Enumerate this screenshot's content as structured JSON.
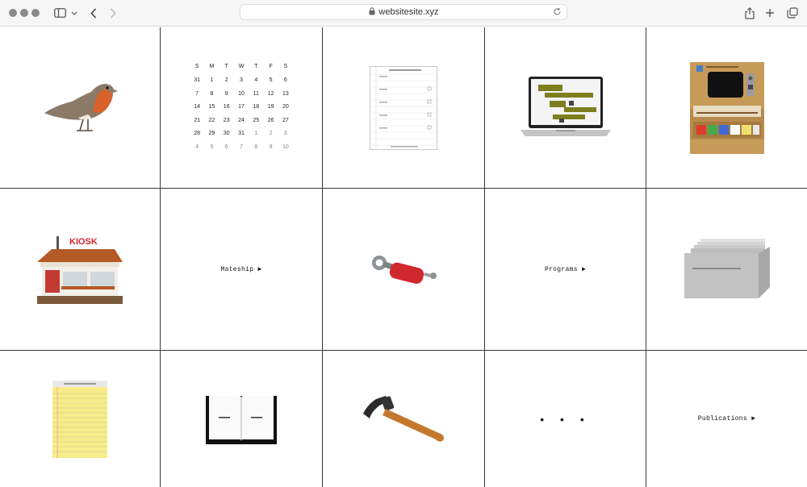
{
  "browser": {
    "url": "websitesite.xyz"
  },
  "calendar": {
    "weekdays": [
      "S",
      "M",
      "T",
      "W",
      "T",
      "F",
      "S"
    ],
    "weeks": [
      [
        {
          "d": "31",
          "m": false
        },
        {
          "d": "1",
          "m": false
        },
        {
          "d": "2",
          "m": false
        },
        {
          "d": "3",
          "m": false
        },
        {
          "d": "4",
          "m": false
        },
        {
          "d": "5",
          "m": false
        },
        {
          "d": "6",
          "m": false
        }
      ],
      [
        {
          "d": "7",
          "m": false
        },
        {
          "d": "8",
          "m": false
        },
        {
          "d": "9",
          "m": false
        },
        {
          "d": "10",
          "m": false
        },
        {
          "d": "11",
          "m": false
        },
        {
          "d": "12",
          "m": false
        },
        {
          "d": "13",
          "m": false
        }
      ],
      [
        {
          "d": "14",
          "m": false
        },
        {
          "d": "15",
          "m": false
        },
        {
          "d": "16",
          "m": false
        },
        {
          "d": "17",
          "m": false
        },
        {
          "d": "18",
          "m": false
        },
        {
          "d": "19",
          "m": false
        },
        {
          "d": "20",
          "m": false
        }
      ],
      [
        {
          "d": "21",
          "m": false
        },
        {
          "d": "22",
          "m": false
        },
        {
          "d": "23",
          "m": false
        },
        {
          "d": "24",
          "m": false
        },
        {
          "d": "25",
          "m": false
        },
        {
          "d": "26",
          "m": false
        },
        {
          "d": "27",
          "m": false
        }
      ],
      [
        {
          "d": "28",
          "m": false
        },
        {
          "d": "29",
          "m": false
        },
        {
          "d": "30",
          "m": false
        },
        {
          "d": "31",
          "m": false
        },
        {
          "d": "1",
          "m": true
        },
        {
          "d": "2",
          "m": true
        },
        {
          "d": "3",
          "m": true
        }
      ],
      [
        {
          "d": "4",
          "m": true
        },
        {
          "d": "5",
          "m": true
        },
        {
          "d": "6",
          "m": true
        },
        {
          "d": "7",
          "m": true
        },
        {
          "d": "8",
          "m": true
        },
        {
          "d": "9",
          "m": true
        },
        {
          "d": "10",
          "m": true
        }
      ]
    ]
  },
  "tiles": {
    "kiosk_sign": "KIOSK",
    "mateship": "Mateship ►",
    "programs": "Programs ►",
    "publications": "Publications ►",
    "more": "• • •"
  },
  "icons": {
    "nav": [
      "sidebar-icon",
      "chevron-down-icon",
      "back-icon",
      "forward-icon",
      "lock-icon",
      "reload-icon",
      "share-icon",
      "plus-icon",
      "tabs-icon"
    ],
    "tiles": [
      "robin-bird-icon",
      "document-sheet-icon",
      "laptop-icon",
      "wooden-monitor-icon",
      "kiosk-icon",
      "pin-tool-icon",
      "file-cabinet-icon",
      "legal-pad-icon",
      "open-book-icon",
      "hammer-icon"
    ]
  }
}
